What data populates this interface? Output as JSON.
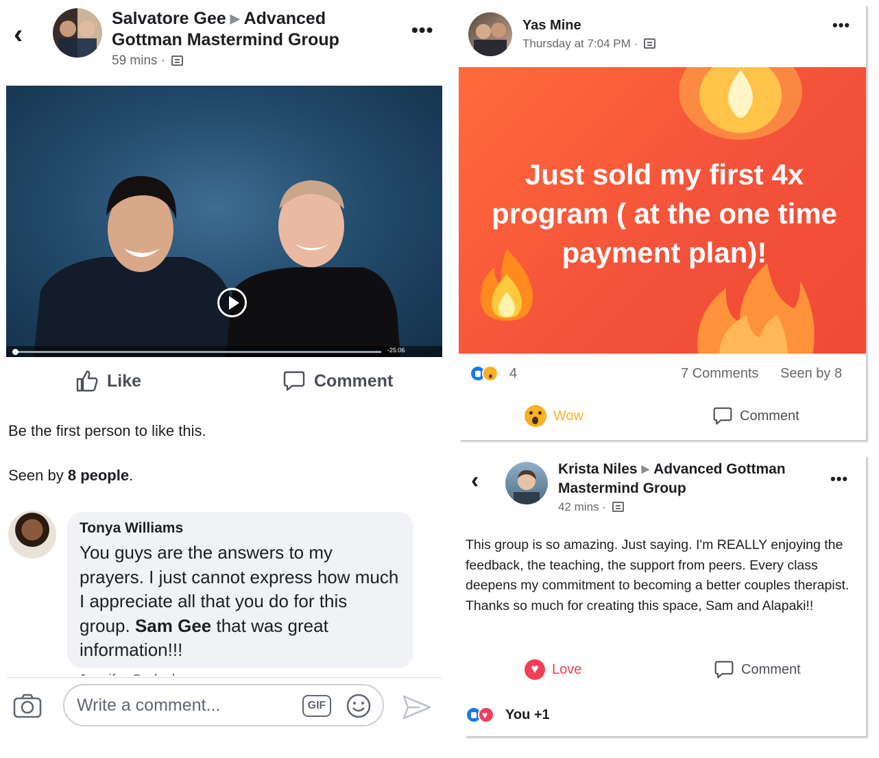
{
  "left_post": {
    "author": "Salvatore Gee",
    "group": "Advanced Gottman Mastermind Group",
    "time": "59 mins",
    "video_time": "-25:06",
    "like_label": "Like",
    "comment_label": "Comment",
    "likes_text": "Be the first person to like this.",
    "seen_prefix": "Seen by ",
    "seen_count": "8 people",
    "seen_suffix": ".",
    "comment": {
      "author": "Tonya Williams",
      "text_part1": "You guys are the answers to my prayers.  I just cannot express how much I appreciate all that you do for this group. ",
      "mention": "Sam Gee",
      "text_part2": " that was great information!!!"
    },
    "next_comment_author": "Jennifer Gerlach",
    "composer": {
      "placeholder": "Write a comment...",
      "gif_label": "GIF"
    }
  },
  "right_top_post": {
    "author": "Yas Mine",
    "time": "Thursday at 7:04 PM",
    "banner_text": "Just sold my first 4x program ( at the one time payment plan)!",
    "reaction_count": "4",
    "comments_count": "7 Comments",
    "seen": "Seen by 8",
    "wow_label": "Wow",
    "comment_label": "Comment",
    "colors": {
      "banner": "#f4523a",
      "wow_text": "#f7b125"
    }
  },
  "right_bottom_post": {
    "author": "Krista Niles",
    "group": "Advanced Gottman Mastermind Group",
    "time": "42 mins",
    "body": "This group is so amazing. Just saying. I'm REALLY enjoying the feedback, the teaching, the support from peers. Every class deepens my commitment to becoming a better couples therapist. Thanks so much for creating this space, Sam and Alapaki!!",
    "love_label": "Love",
    "comment_label": "Comment",
    "reactions_text": "You +1",
    "colors": {
      "love": "#f33e58"
    }
  }
}
